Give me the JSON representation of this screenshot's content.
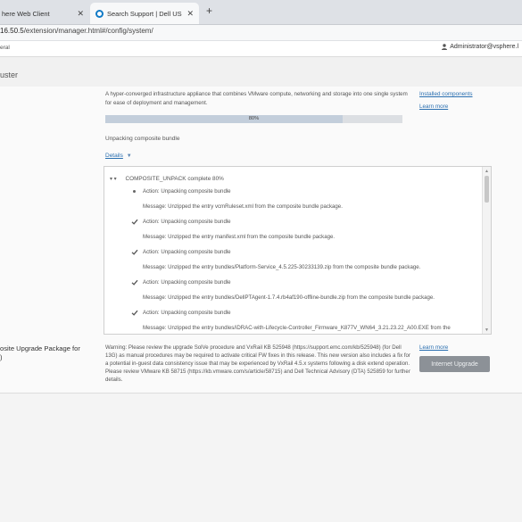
{
  "browser": {
    "tabs": [
      {
        "label": "here Web Client",
        "close": "✕"
      },
      {
        "label": "Search Support | Dell US",
        "close": "✕"
      }
    ],
    "new_tab": "+",
    "url_host": "16.50.5",
    "url_path": "/extension/manager.html#/config/system/"
  },
  "header": {
    "left_text": "eral",
    "user": "Administrator@vsphere.l"
  },
  "cluster": {
    "title": "uster"
  },
  "system": {
    "description": "A hyper-converged infrastructure appliance that combines VMware compute, networking and storage into one single system for ease of deployment and management.",
    "installed_components": "Installed components",
    "learn_more": "Learn more",
    "progress_percent": 80,
    "progress_label": "80%",
    "status": "Unpacking composite bundle",
    "details": "Details",
    "details_chevron": "▼"
  },
  "log": {
    "header_carets": "▾ ▾",
    "header": "COMPOSITE_UNPACK complete 80%",
    "entries": [
      {
        "mark": "dot",
        "action": "Action: Unpacking composite bundle",
        "message": "Message: Unzipped the entry vcmRuleset.xml from the composite bundle package."
      },
      {
        "mark": "check",
        "action": "Action: Unpacking composite bundle",
        "message": "Message: Unzipped the entry manifest.xml from the composite bundle package."
      },
      {
        "mark": "check",
        "action": "Action: Unpacking composite bundle",
        "message": "Message: Unzipped the entry bundles/Platform-Service_4.5.225-30233139.zip from the composite bundle package."
      },
      {
        "mark": "check",
        "action": "Action: Unpacking composite bundle",
        "message": "Message: Unzipped the entry bundles/DellPTAgent-1.7.4.rb4af190-offline-bundle.zip from the composite bundle package."
      },
      {
        "mark": "check",
        "action": "Action: Unpacking composite bundle",
        "message": "Message: Unzipped the entry bundles/iDRAC-with-Lifecycle-Controller_Firmware_K877V_WN64_3.21.23.22_A00.EXE from the"
      }
    ]
  },
  "package": {
    "label": "osite Upgrade Package for\n)",
    "warning": "Warning: Please review the upgrade SolVe procedure and VxRail KB 525948 (https://support.emc.com/kb/525948) (for Dell 13G) as manual procedures may be required to activate critical FW fixes in this release. This new version also includes a fix for a potential in-guest data consistency issue that may be experienced by VxRail 4.5.x systems following a disk extend operation. Please review VMware KB 58715 (https://kb.vmware.com/s/article/58715) and Dell Technical Advisory (DTA) 525859 for further details.",
    "learn_more": "Learn more",
    "upgrade_button": "Internet Upgrade"
  },
  "colors": {
    "accent_link": "#2a6fb0",
    "button_disabled": "#8c9197",
    "progress_fill": "#c3cedb"
  }
}
